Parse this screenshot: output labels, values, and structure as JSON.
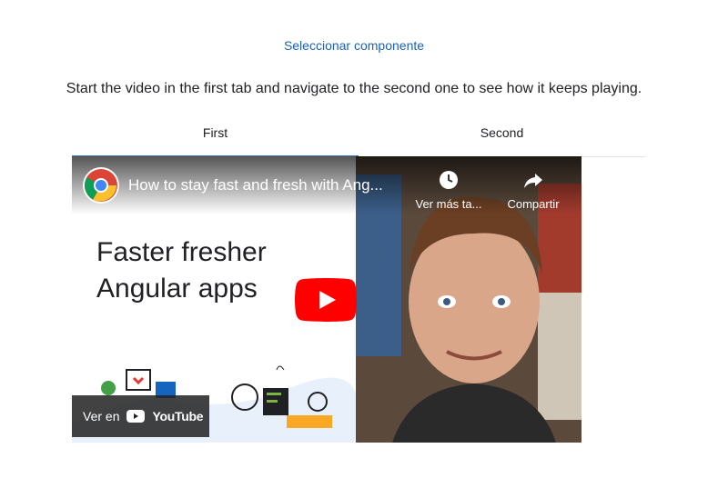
{
  "header": {
    "select_component": "Seleccionar componente",
    "description": "Start the video in the first tab and navigate to the second one to see how it keeps playing."
  },
  "tabs": [
    {
      "label": "First",
      "active": true
    },
    {
      "label": "Second",
      "active": false
    }
  ],
  "video": {
    "title": "How to stay fast and fresh with Ang...",
    "thumbnail_text_line1": "Faster fresher",
    "thumbnail_text_line2": "Angular apps",
    "watch_later_label": "Ver más ta...",
    "share_label": "Compartir",
    "watch_on_label": "Ver en",
    "youtube_label": "YouTube"
  },
  "colors": {
    "link": "#1a62b8",
    "tab_indicator": "#3f6fb0",
    "play_red": "#ff0000"
  }
}
